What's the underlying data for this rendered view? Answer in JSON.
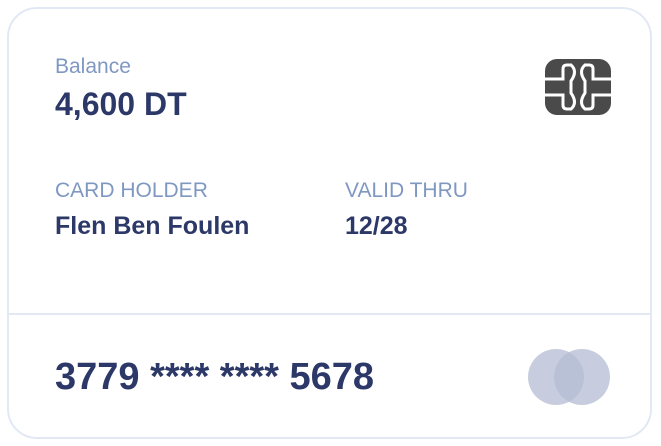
{
  "card": {
    "balance_label": "Balance",
    "balance_value": "4,600 DT",
    "holder_label": "CARD HOLDER",
    "holder_name": "Flen Ben Foulen",
    "valid_label": "VALID THRU",
    "valid_value": "12/28",
    "number": "3779 **** **** 5678",
    "chip_icon": "sim-chip-icon",
    "brand_icon": "mastercard-circles-icon"
  },
  "colors": {
    "label": "#7f98c2",
    "value": "#2c3867",
    "chip": "#4a4a4a",
    "logo_circle": "#b4bcd3",
    "border": "#e3e9f4"
  }
}
